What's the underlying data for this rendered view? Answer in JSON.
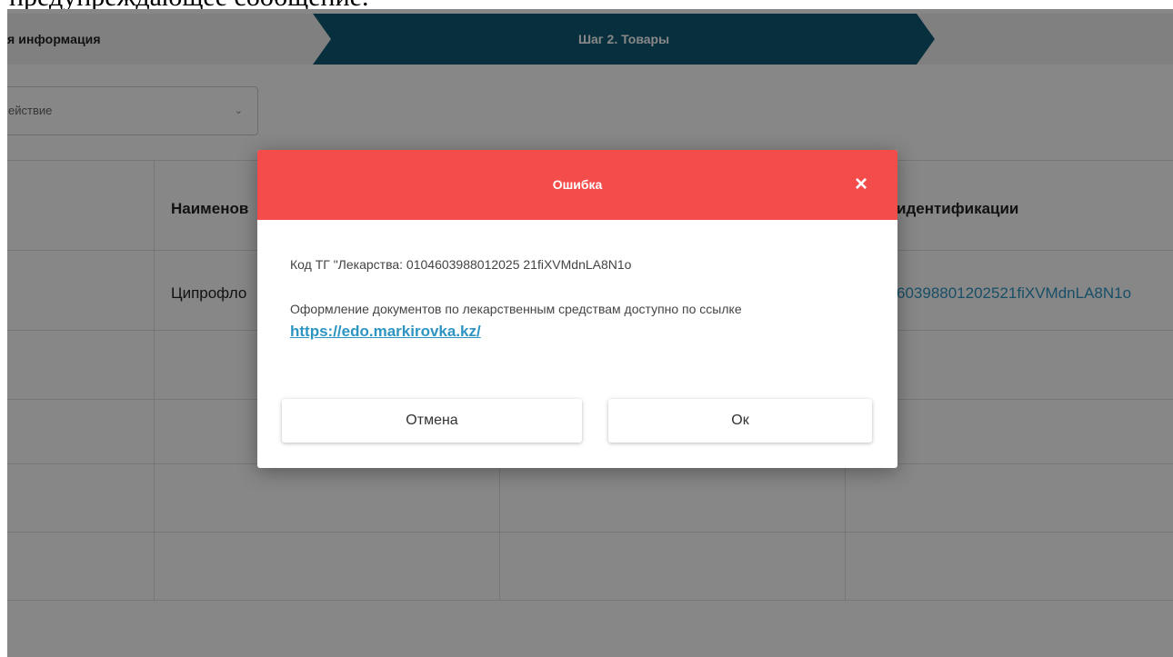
{
  "caption": "предупреждающее сообщение.",
  "stepper": {
    "step1_label": "я информация",
    "step2_label": "Шаг 2. Товары",
    "active_color": "#0e5a73"
  },
  "action_select": {
    "value": "ействие"
  },
  "table": {
    "headers": {
      "name": "Наименов",
      "identification": "идентификации"
    },
    "rows": [
      {
        "name": "Ципрофло",
        "code": "60398801202521fiXVMdnLA8N1o"
      }
    ]
  },
  "modal": {
    "title": "Ошибка",
    "header_color": "#f44b4b",
    "close_icon": "×",
    "message_code": "Код ТГ \"Лекарства: 0104603988012025 21fiXVMdnLA8N1o",
    "message_info": "Оформление документов по лекарственным средствам доступно по ссылке",
    "link_text": "https://edo.markirovka.kz/",
    "cancel_label": "Отмена",
    "ok_label": "Ок"
  }
}
